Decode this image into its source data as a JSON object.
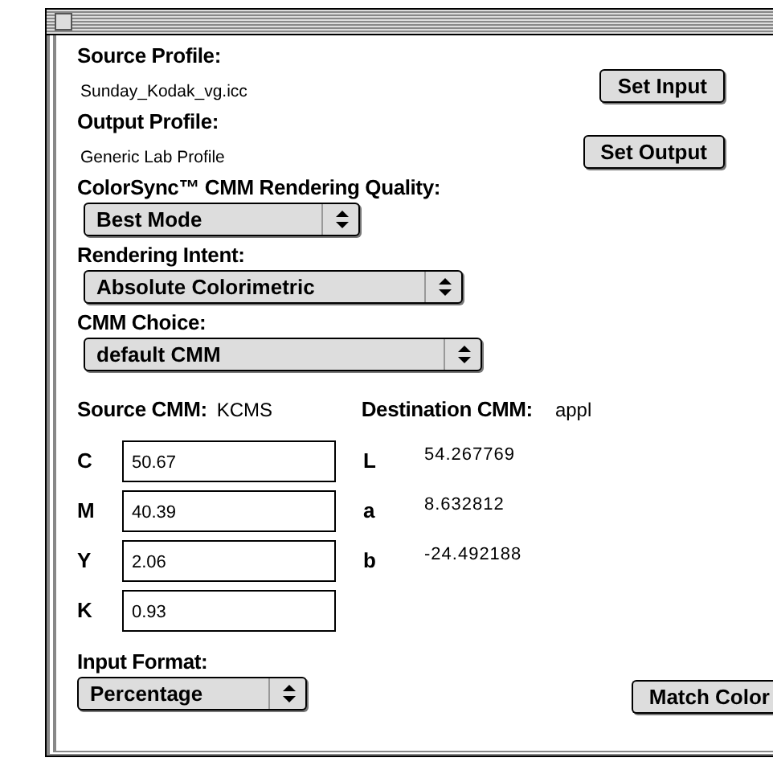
{
  "profiles": [
    {
      "label": "Source Profile:",
      "value": "Sunday_Kodak_vg.icc",
      "button": "Set Input"
    },
    {
      "label": "Output Profile:",
      "value": "Generic Lab Profile",
      "button": "Set Output"
    }
  ],
  "popups": [
    {
      "label": "ColorSync™ CMM Rendering Quality:",
      "value": "Best Mode"
    },
    {
      "label": "Rendering Intent:",
      "value": "Absolute Colorimetric"
    },
    {
      "label": "CMM Choice:",
      "value": "default CMM"
    }
  ],
  "cmm": {
    "source_label": "Source CMM:",
    "source_value": "KCMS",
    "destination_label": "Destination CMM:",
    "destination_value": "appl"
  },
  "cmyk": [
    {
      "label": "C",
      "value": "50.67"
    },
    {
      "label": "M",
      "value": "40.39"
    },
    {
      "label": "Y",
      "value": "2.06"
    },
    {
      "label": "K",
      "value": "0.93"
    }
  ],
  "lab": [
    {
      "label": "L",
      "value": "54.267769"
    },
    {
      "label": "a",
      "value": "8.632812"
    },
    {
      "label": "b",
      "value": "-24.492188"
    }
  ],
  "input_format": {
    "label": "Input Format:",
    "value": "Percentage"
  },
  "match_button": "Match Color"
}
